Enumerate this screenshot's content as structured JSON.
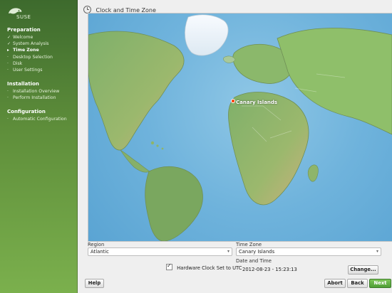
{
  "window": {
    "title": "Clock and Time Zone"
  },
  "sidebar": {
    "logo_text": "SUSE",
    "sections": [
      {
        "title": "Preparation",
        "items": [
          {
            "label": "Welcome",
            "state": "done"
          },
          {
            "label": "System Analysis",
            "state": "done"
          },
          {
            "label": "Time Zone",
            "state": "current"
          },
          {
            "label": "Desktop Selection",
            "state": "todo"
          },
          {
            "label": "Disk",
            "state": "todo"
          },
          {
            "label": "User Settings",
            "state": "todo"
          }
        ]
      },
      {
        "title": "Installation",
        "items": [
          {
            "label": "Installation Overview",
            "state": "todo"
          },
          {
            "label": "Perform Installation",
            "state": "todo"
          }
        ]
      },
      {
        "title": "Configuration",
        "items": [
          {
            "label": "Automatic Configuration",
            "state": "todo"
          }
        ]
      }
    ],
    "marks": {
      "done": "✓",
      "current": "▸",
      "todo": "·"
    }
  },
  "map": {
    "selected_label": "Canary Islands"
  },
  "form": {
    "region_label": "Region",
    "region_value": "Atlantic",
    "timezone_label": "Time Zone",
    "timezone_value": "Canary Islands",
    "hardware_clock_label": "Hardware Clock Set to UTC",
    "hardware_clock_checked": true,
    "date_time_label": "Date and Time",
    "date_time_value": "2012-08-23 - 15:23:13",
    "change_button": "Change..."
  },
  "buttons": {
    "help": "Help",
    "abort": "Abort",
    "back": "Back",
    "next": "Next"
  }
}
